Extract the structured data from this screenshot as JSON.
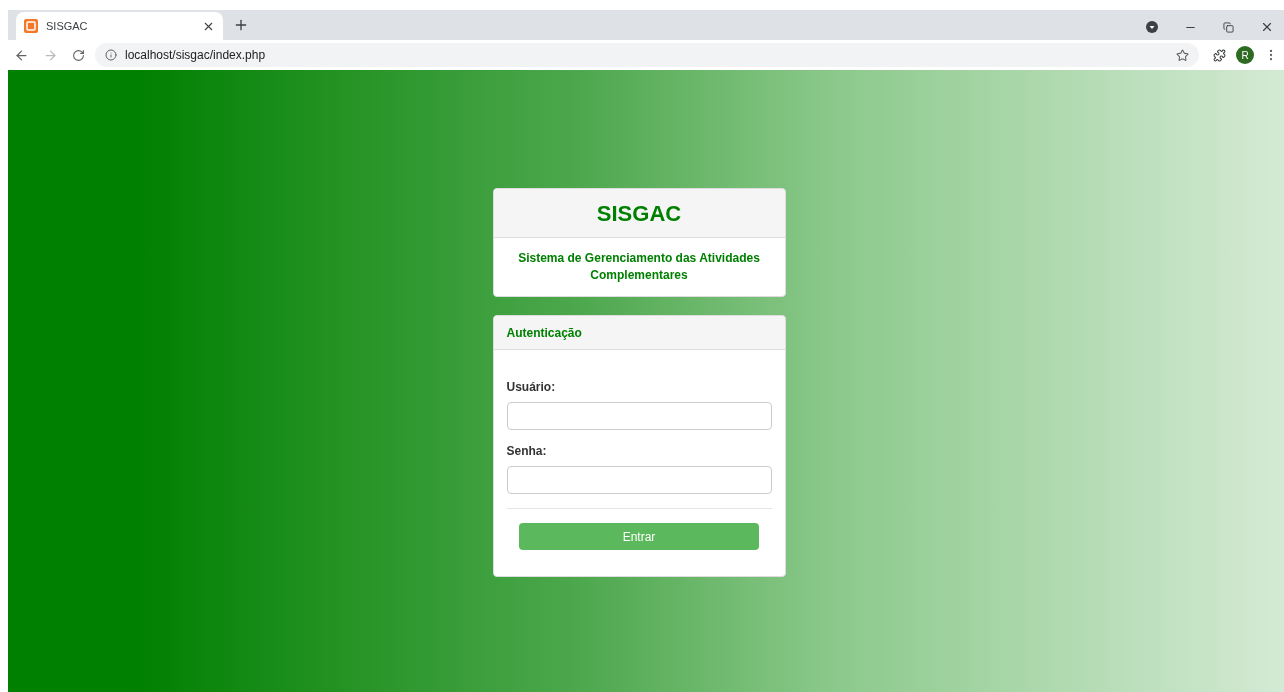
{
  "browser": {
    "tab": {
      "title": "SISGAC",
      "selected": true
    },
    "address": "localhost/sisgac/index.php",
    "profile_initial": "R"
  },
  "header_card": {
    "title": "SISGAC",
    "subtitle": "Sistema de Gerenciamento das Atividades Complementares"
  },
  "login_card": {
    "title": "Autenticação",
    "fields": [
      {
        "label": "Usuário:"
      },
      {
        "label": "Senha:"
      }
    ],
    "button": "Entrar"
  }
}
